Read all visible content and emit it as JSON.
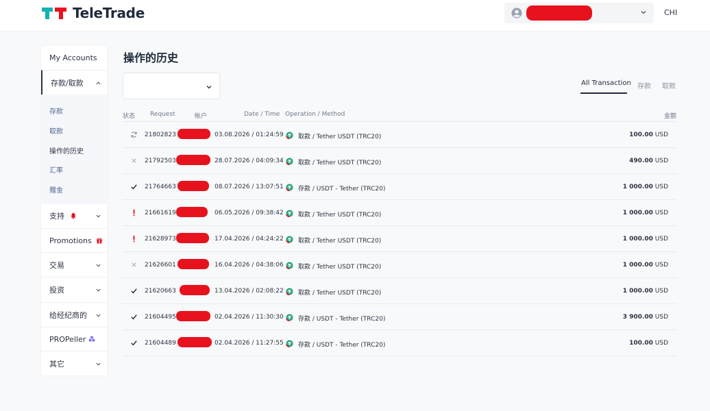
{
  "brand": {
    "name": "TeleTrade"
  },
  "header": {
    "language": "CHI"
  },
  "sidebar": {
    "my_accounts": "My Accounts",
    "deposit_withdraw": "存款/取款",
    "submenu": [
      "存款",
      "取款",
      "操作的历史",
      "汇率",
      "赠金"
    ],
    "support": "支持",
    "promotions": "Promotions",
    "trading": "交易",
    "investment": "投资",
    "for_brokers": "给经纪商的",
    "propeller": "PROPeller",
    "other": "其它"
  },
  "page": {
    "title": "操作的历史"
  },
  "tabs": {
    "all": "All Transaction",
    "deposit": "存款",
    "withdraw": "取款"
  },
  "table": {
    "headers": {
      "status": "状态",
      "request": "Request",
      "account": "帐户",
      "date": "Date / Time",
      "operation": "Operation / Method",
      "amount": "金额"
    },
    "rows": [
      {
        "status": "pending",
        "request": "21802823",
        "date": "03.08.2026 / 01:24:59",
        "operation": "取款 / Tether USDT (TRC20)",
        "amount": "100.00",
        "currency": "USD"
      },
      {
        "status": "cancelled",
        "request": "21792503",
        "date": "28.07.2026 / 04:09:34",
        "operation": "取款 / Tether USDT (TRC20)",
        "amount": "490.00",
        "currency": "USD"
      },
      {
        "status": "done",
        "request": "21764663",
        "date": "08.07.2026 / 13:07:51",
        "operation": "存款 / USDT - Tether (TRC20)",
        "amount": "1 000.00",
        "currency": "USD"
      },
      {
        "status": "error",
        "request": "21661619",
        "date": "06.05.2026 / 09:38:42",
        "operation": "取款 / Tether USDT (TRC20)",
        "amount": "1 000.00",
        "currency": "USD"
      },
      {
        "status": "error",
        "request": "21628973",
        "date": "17.04.2026 / 04:24:22",
        "operation": "取款 / Tether USDT (TRC20)",
        "amount": "1 000.00",
        "currency": "USD"
      },
      {
        "status": "cancelled",
        "request": "21626601",
        "date": "16.04.2026 / 04:38:06",
        "operation": "取款 / Tether USDT (TRC20)",
        "amount": "1 000.00",
        "currency": "USD"
      },
      {
        "status": "done",
        "request": "21620663",
        "date": "13.04.2026 / 02:08:22",
        "operation": "取款 / Tether USDT (TRC20)",
        "amount": "1 000.00",
        "currency": "USD"
      },
      {
        "status": "done",
        "request": "21604495",
        "date": "02.04.2026 / 11:30:30",
        "operation": "存款 / USDT - Tether (TRC20)",
        "amount": "3 900.00",
        "currency": "USD"
      },
      {
        "status": "done",
        "request": "21604489",
        "date": "02.04.2026 / 11:27:55",
        "operation": "存款 / USDT - Tether (TRC20)",
        "amount": "100.00",
        "currency": "USD"
      }
    ]
  },
  "colors": {
    "accent_teal": "#12b3b3",
    "accent_red": "#e8121e",
    "text_dark": "#1f2a3c",
    "link_blue": "#4d6a8f",
    "usdt_green": "#27a17c"
  }
}
